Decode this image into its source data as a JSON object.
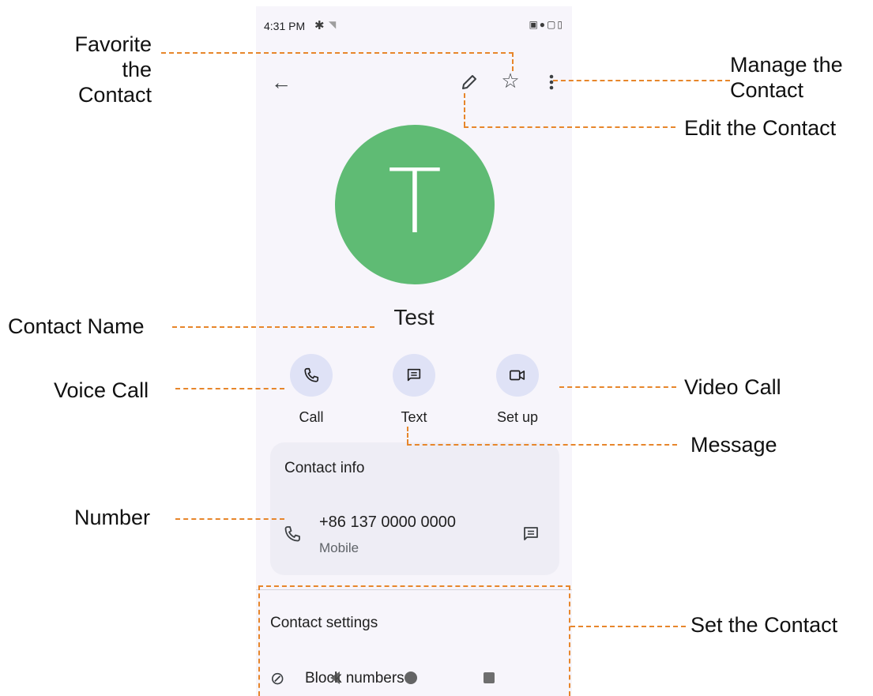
{
  "status_bar": {
    "time": "4:31 PM"
  },
  "contact": {
    "initial": "T",
    "name": "Test",
    "avatar_color": "#5fbb74"
  },
  "actions": [
    {
      "label": "Call",
      "icon": "phone-icon"
    },
    {
      "label": "Text",
      "icon": "message-icon"
    },
    {
      "label": "Set up",
      "icon": "video-icon"
    }
  ],
  "contact_info": {
    "title": "Contact info",
    "number": "+86 137 0000 0000",
    "type": "Mobile"
  },
  "contact_settings": {
    "title": "Contact settings",
    "block_label": "Block numbers"
  },
  "annotations": {
    "favorite": [
      "Favorite the",
      "Contact"
    ],
    "manage": [
      "Manage the",
      "Contact"
    ],
    "edit": "Edit the Contact",
    "contact_name": "Contact Name",
    "voice_call": "Voice Call",
    "video_call": "Video Call",
    "message": "Message",
    "number": "Number",
    "set_contact": "Set the Contact"
  },
  "colors": {
    "annotation_line": "#e7862b",
    "action_circle": "#dfe2f6",
    "screen_background": "#f7f5fb",
    "card_background": "#eeedf5"
  }
}
